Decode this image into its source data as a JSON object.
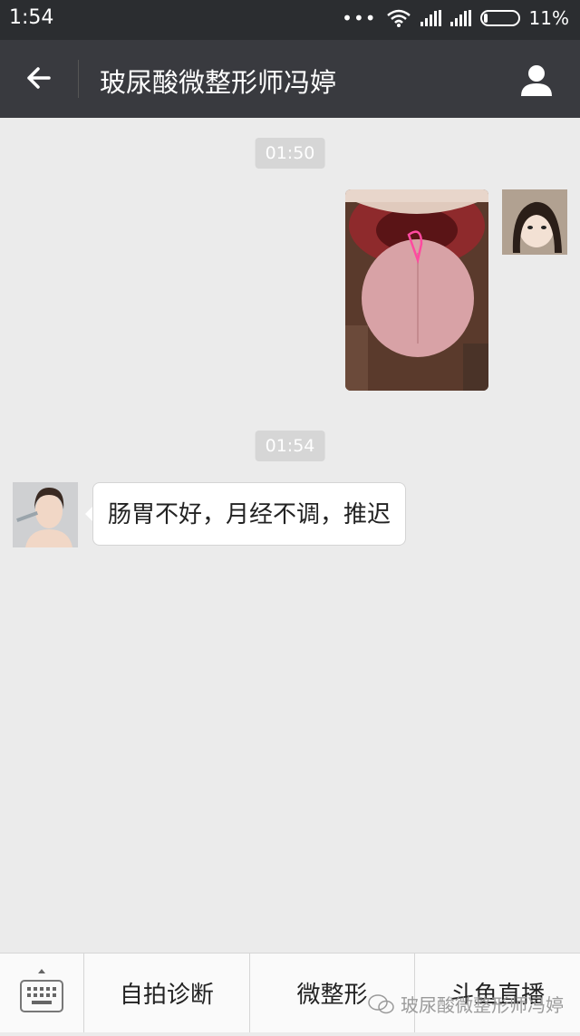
{
  "status": {
    "time": "1:54",
    "battery": "11%",
    "battery_fraction": 0.11
  },
  "header": {
    "title": "玻尿酸微整形师冯婷"
  },
  "messages": {
    "time1": "01:50",
    "time2": "01:54",
    "text1": "肠胃不好，月经不调，推迟"
  },
  "menu": {
    "item1": "自拍诊断",
    "item2": "微整形",
    "item3": "斗鱼直播"
  },
  "watermark": "玻尿酸微整形师冯婷",
  "colors": {
    "titlebar": "#393a3f",
    "statusbar": "#2b2d30",
    "background": "#ebebeb"
  }
}
